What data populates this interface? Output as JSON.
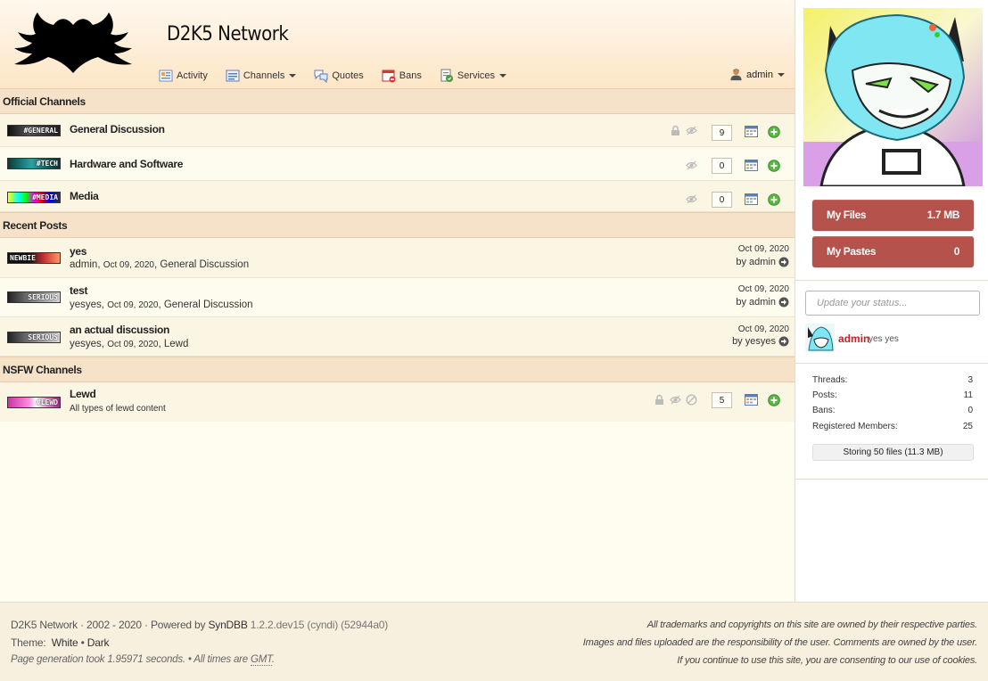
{
  "site": {
    "title": "D2K5 Network"
  },
  "nav": {
    "activity": "Activity",
    "channels": "Channels",
    "quotes": "Quotes",
    "bans": "Bans",
    "services": "Services",
    "user": "admin"
  },
  "sections": {
    "official": "Official Channels",
    "recent": "Recent Posts",
    "nsfw": "NSFW Channels"
  },
  "official_channels": [
    {
      "banner": "#GENERAL",
      "name": "General Discussion",
      "count": "9",
      "color": "#2b2b2b"
    },
    {
      "banner": "#TECH",
      "name": "Hardware and Software",
      "count": "0",
      "color": "#1d6f6f"
    },
    {
      "banner": "#MEDIA",
      "name": "Media",
      "count": "0",
      "color": "#8a3fae"
    }
  ],
  "recent_posts": [
    {
      "banner": "NEWBIE",
      "title": "yes",
      "author": "admin",
      "date": "Oct 09, 2020",
      "channel": "General Discussion",
      "right_date": "Oct 09, 2020",
      "by_label": "by",
      "by": "admin"
    },
    {
      "banner": "SERIOUS",
      "title": "test",
      "author": "yesyes",
      "date": "Oct 09, 2020",
      "channel": "General Discussion",
      "right_date": "Oct 09, 2020",
      "by_label": "by",
      "by": "admin"
    },
    {
      "banner": "SERIOUS",
      "title": "an actual discussion",
      "author": "yesyes",
      "date": "Oct 09, 2020",
      "channel": "Lewd",
      "right_date": "Oct 09, 2020",
      "by_label": "by",
      "by": "yesyes"
    }
  ],
  "nsfw_channels": [
    {
      "banner": "#LEWD",
      "name": "Lewd",
      "desc": "All types of lewd content",
      "count": "5"
    }
  ],
  "sidebar": {
    "my_files_label": "My Files",
    "my_files_value": "1.7 MB",
    "my_pastes_label": "My Pastes",
    "my_pastes_value": "0",
    "status_placeholder": "Update your status...",
    "status_user": "admin",
    "status_text": "yes yes",
    "stats": [
      {
        "label": "Threads:",
        "value": "3"
      },
      {
        "label": "Posts:",
        "value": "11"
      },
      {
        "label": "Bans:",
        "value": "0"
      },
      {
        "label": "Registered Members:",
        "value": "25"
      }
    ],
    "storage": "Storing 50 files (11.3 MB)"
  },
  "footer": {
    "line1": "D2K5 Network · 2002 - 2020 · Powered by",
    "syndbb": "SynDBB",
    "version": "1.2.2.dev15 (cyndi) (52944a0)",
    "theme_label": "Theme:",
    "theme_white": "White",
    "theme_sep": "•",
    "theme_dark": "Dark",
    "gen_prefix": "Page generation took 1.95971 seconds. • All times are",
    "gen_tz": "GMT",
    "gen_suffix": ".",
    "right1": "All trademarks and copyrights on this site are owned by their respective parties.",
    "right2": "Images and files uploaded are the responsibility of the user. Comments are owned by the user.",
    "right3": "If you continue to use this site, you are consenting to our use of cookies."
  },
  "colors": {
    "accent": "#b5524c",
    "header_bg": "#fde6c7",
    "section_bg": "#f6e2c8",
    "user_red": "#c62020"
  }
}
